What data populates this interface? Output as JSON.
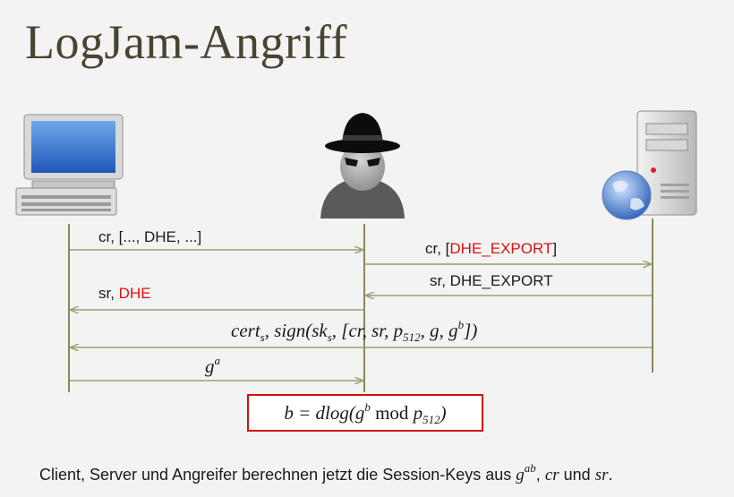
{
  "slide": {
    "title": "LogJam-Angriff"
  },
  "actors": [
    {
      "id": "client",
      "icon": "desktop-computer-icon"
    },
    {
      "id": "attacker",
      "icon": "spy-hat-icon"
    },
    {
      "id": "server",
      "icon": "web-server-icon"
    }
  ],
  "messages": {
    "m1": {
      "text": "cr, [..., DHE, ...]",
      "from": "client",
      "to": "attacker"
    },
    "m2": {
      "prefix": "cr, [",
      "highlight": "DHE_EXPORT",
      "suffix": "]",
      "from": "attacker",
      "to": "server"
    },
    "m3": {
      "text": "sr, DHE_EXPORT",
      "from": "server",
      "to": "attacker"
    },
    "m4": {
      "prefix": "sr, ",
      "highlight": "DHE",
      "from": "attacker",
      "to": "client"
    },
    "m5": {
      "cert": "cert",
      "cert_sub": "s",
      "sign": ", sign(sk",
      "sign_sub": "s",
      "mid": ", [cr, sr, p",
      "p_sub": "512",
      "g": ", g, g",
      "g_sup": "b",
      "close": "])",
      "from": "server",
      "to": "client"
    },
    "m6": {
      "base": "g",
      "sup": "a",
      "from": "client",
      "to": "attacker"
    }
  },
  "formula": {
    "left": "b = dlog(g",
    "sup": "b",
    "mod": " mod ",
    "p": "p",
    "p_sub": "512",
    "close": ")"
  },
  "footer": {
    "text": "Client, Server und Angreifer berechnen jetzt die Session-Keys aus ",
    "key_base": "g",
    "key_sup": "ab",
    "sep1": ", ",
    "cr": "cr",
    "und": " und ",
    "sr": "sr",
    "end": "."
  },
  "colors": {
    "title": "#4a4330",
    "highlight": "#e01010",
    "box_border": "#d31010",
    "lifeline": "#8a8a5a",
    "arrow": "#9aa070"
  }
}
